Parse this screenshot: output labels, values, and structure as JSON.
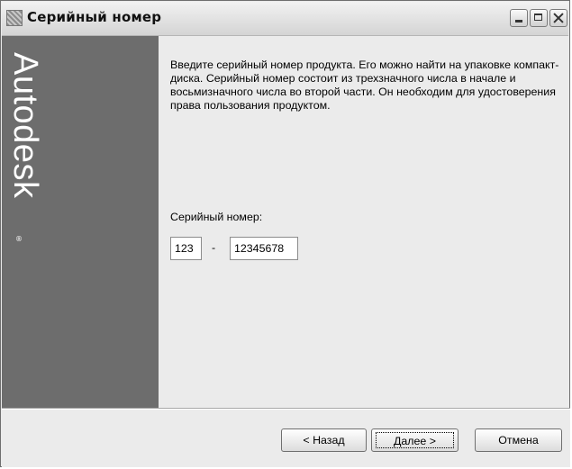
{
  "window": {
    "title": "Серийный номер"
  },
  "sidebar": {
    "brand": "Autodesk",
    "brand_mark": "®"
  },
  "content": {
    "description": "Введите серийный номер продукта. Его можно найти на упаковке компакт-диска. Серийный номер состоит из трехзначного числа в начале и восьмизначного числа во второй части. Он необходим для удостоверения права пользования продуктом.",
    "serial_label": "Серийный номер:",
    "serial_prefix_value": "123",
    "separator": "-",
    "serial_main_value": "12345678"
  },
  "footer": {
    "back_label": "< Назад",
    "next_label": "Далее >",
    "cancel_label": "Отмена"
  },
  "icons": {
    "app": "product-install-icon",
    "minimize": "minimize-icon",
    "maximize": "maximize-icon",
    "close": "close-icon"
  }
}
